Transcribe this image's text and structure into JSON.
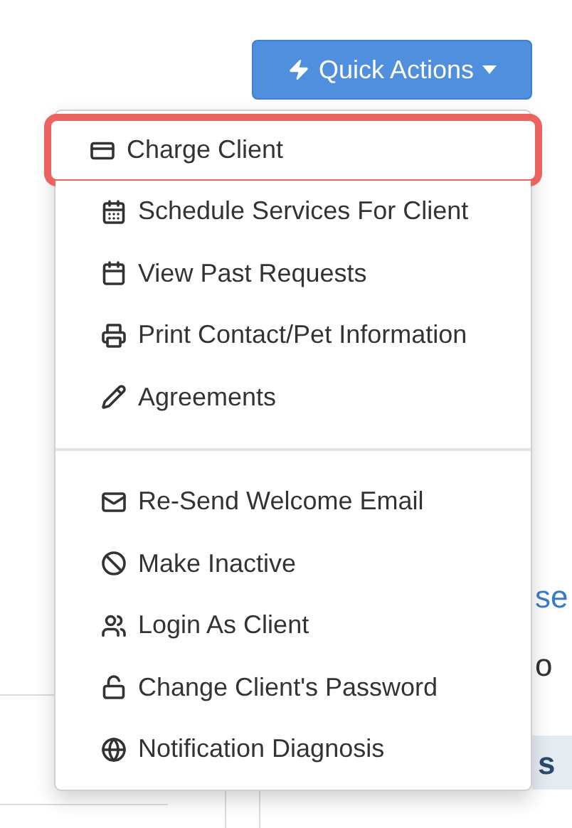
{
  "quick_actions_button": {
    "label": "Quick Actions"
  },
  "menu": {
    "groups": [
      {
        "items": [
          {
            "label": "Charge Client",
            "highlighted": true
          },
          {
            "label": "Schedule Services For Client",
            "highlighted": false
          },
          {
            "label": "View Past Requests",
            "highlighted": false
          },
          {
            "label": "Print Contact/Pet Information",
            "highlighted": false
          },
          {
            "label": "Agreements",
            "highlighted": false
          }
        ]
      },
      {
        "items": [
          {
            "label": "Re-Send Welcome Email",
            "highlighted": false
          },
          {
            "label": "Make Inactive",
            "highlighted": false
          },
          {
            "label": "Login As Client",
            "highlighted": false
          },
          {
            "label": "Change Client's Password",
            "highlighted": false
          },
          {
            "label": "Notification Diagnosis",
            "highlighted": false
          }
        ]
      }
    ]
  },
  "background": {
    "link_fragment": "se",
    "text_fragment": "o",
    "heading_fragment": "s"
  }
}
